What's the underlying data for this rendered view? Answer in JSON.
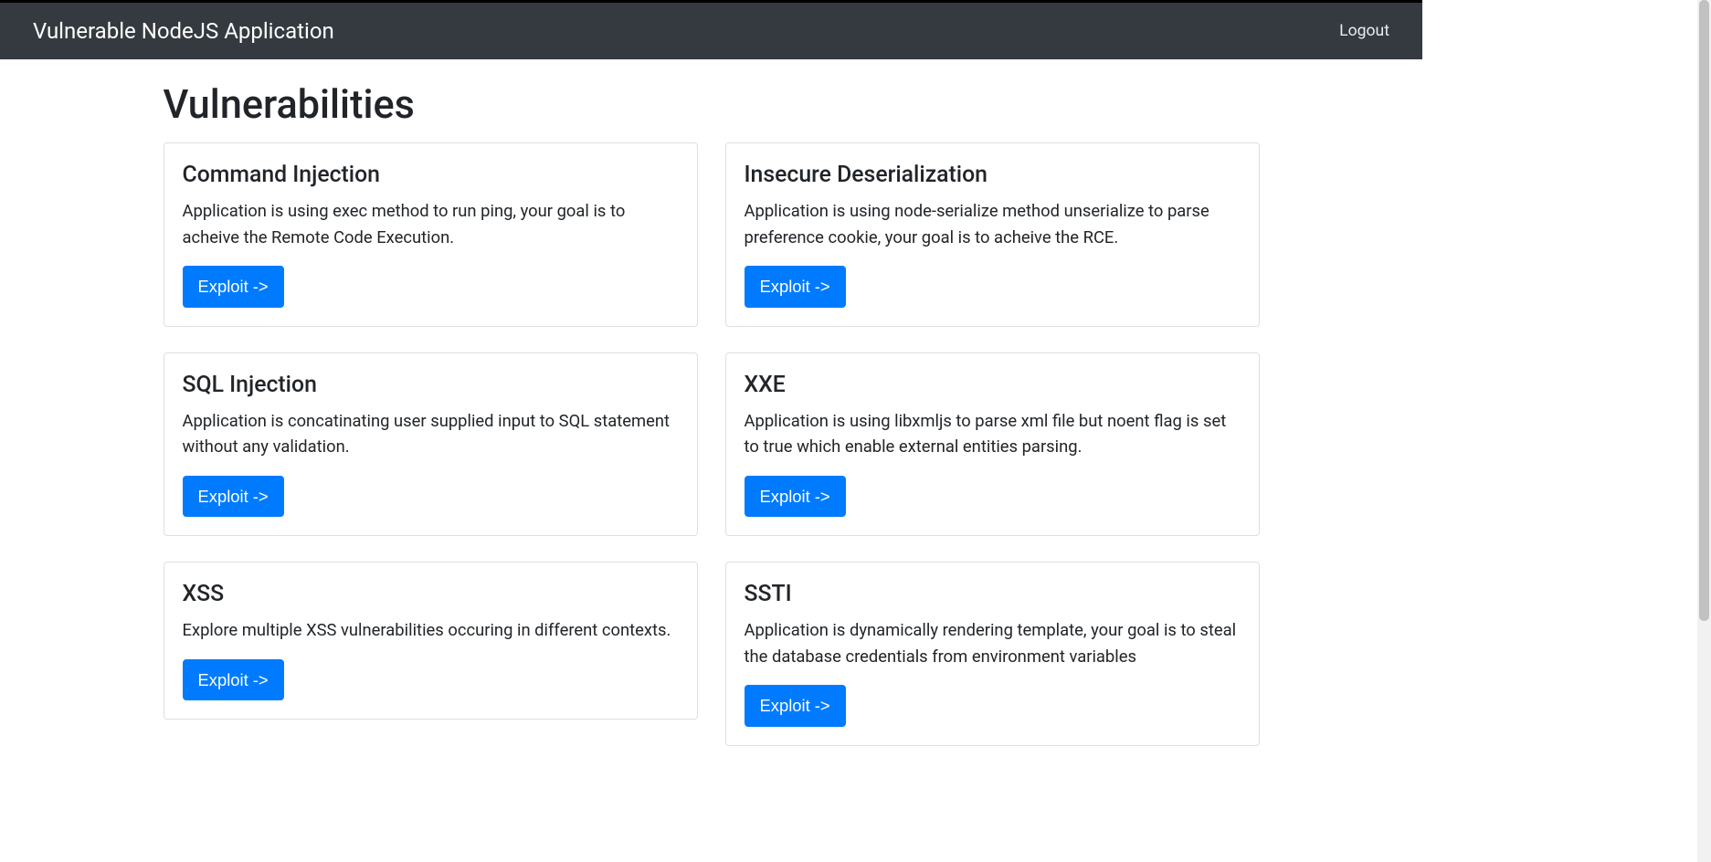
{
  "navbar": {
    "brand": "Vulnerable NodeJS Application",
    "logout": "Logout"
  },
  "page": {
    "title": "Vulnerabilities",
    "button_label": "Exploit ->"
  },
  "cards": [
    {
      "title": "Command Injection",
      "text": "Application is using exec method to run ping, your goal is to acheive the Remote Code Execution."
    },
    {
      "title": "Insecure Deserialization",
      "text": "Application is using node-serialize method unserialize to parse preference cookie, your goal is to acheive the RCE."
    },
    {
      "title": "SQL Injection",
      "text": "Application is concatinating user supplied input to SQL statement without any validation."
    },
    {
      "title": "XXE",
      "text": "Application is using libxmljs to parse xml file but noent flag is set to true which enable external entities parsing."
    },
    {
      "title": "XSS",
      "text": "Explore multiple XSS vulnerabilities occuring in different contexts."
    },
    {
      "title": "SSTI",
      "text": "Application is dynamically rendering template, your goal is to steal the database credentials from environment variables"
    }
  ]
}
